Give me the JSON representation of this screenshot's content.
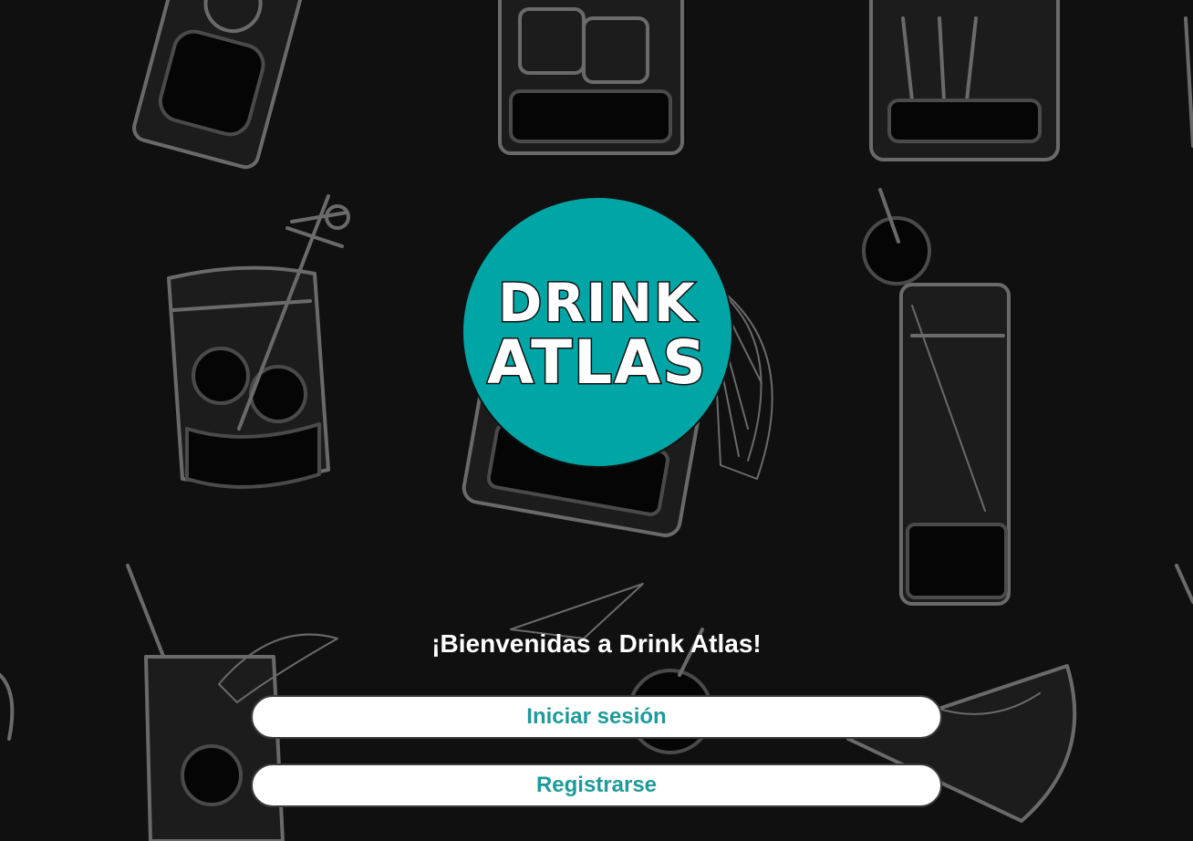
{
  "logo": {
    "line1": "DRINK",
    "line2": "ATLAS",
    "background_color": "#00a5a5"
  },
  "welcome_text": "¡Bienvenidas a Drink Atlas!",
  "buttons": {
    "login_label": "Iniciar sesión",
    "register_label": "Registrarse",
    "text_color": "#1e9a9a"
  },
  "background": {
    "color": "#101010",
    "pattern": "cocktail-glass-sketches"
  }
}
